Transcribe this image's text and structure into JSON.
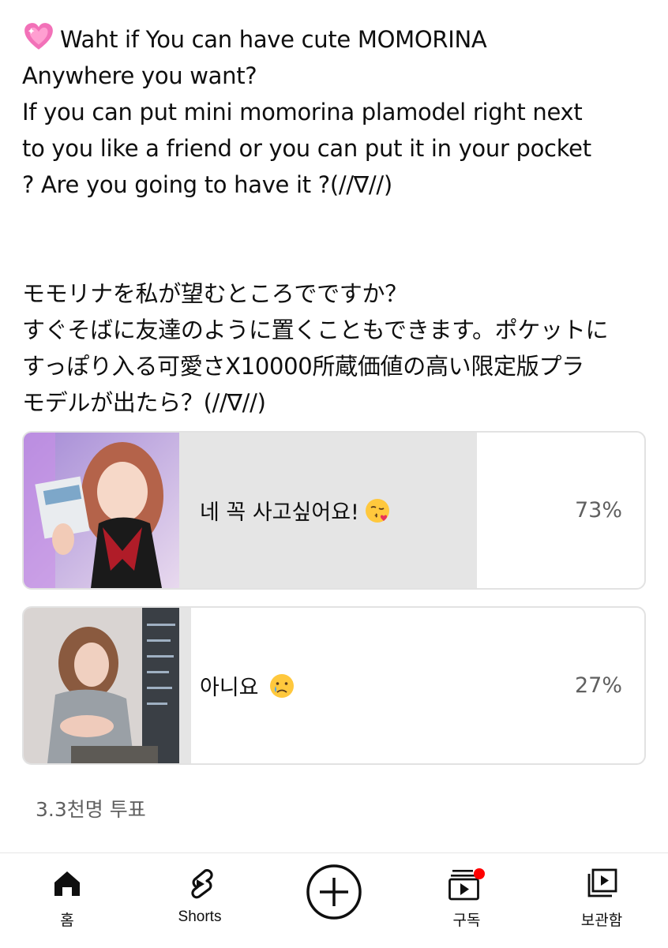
{
  "post": {
    "lines_en": [
      "Waht if You can have cute MOMORINA",
      "Anywhere you want?",
      "If you can put mini momorina plamodel right next",
      "to you like a friend or you can put it in your pocket",
      "? Are you going to have it ?(//∇//)"
    ],
    "lines_ja": [
      "モモリナを私が望むところでですか？",
      "すぐそばに友達のように置くこともできます。ポケットに",
      "すっぽり入る可愛さX10000所蔵価値の高い限定版プラ",
      "モデルが出たら？(//∇//)"
    ]
  },
  "poll": {
    "options": [
      {
        "label": "네 꼭 사고싶어요!",
        "emoji": "kissing-face-heart-emoji",
        "percent": "73%",
        "fill_fraction": 0.73
      },
      {
        "label": "아니요",
        "emoji": "crying-face-emoji",
        "percent": "27%",
        "fill_fraction": 0.27
      }
    ],
    "votes": "3.3천명 투표"
  },
  "nav": {
    "home": "홈",
    "shorts": "Shorts",
    "subscriptions": "구독",
    "library": "보관함"
  },
  "colors": {
    "fill": "#e5e5e5",
    "border": "#e2e2e2",
    "notification_dot": "#ff0000",
    "text_secondary": "#606060"
  }
}
